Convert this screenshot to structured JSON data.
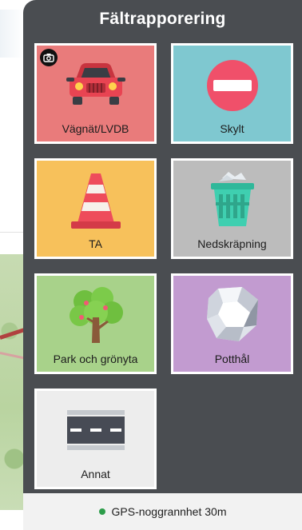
{
  "panel": {
    "title": "Fältrapporering"
  },
  "tiles": [
    {
      "label": "Vägnät/LVDB",
      "icon": "car-icon",
      "color": "#e97b7b"
    },
    {
      "label": "Skylt",
      "icon": "no-entry-sign-icon",
      "color": "#7fc8d0"
    },
    {
      "label": "TA",
      "icon": "traffic-cone-icon",
      "color": "#f7c15b"
    },
    {
      "label": "Nedskräpning",
      "icon": "trash-bin-icon",
      "color": "#bcbcbc"
    },
    {
      "label": "Park och grönyta",
      "icon": "tree-icon",
      "color": "#a8d28a"
    },
    {
      "label": "Potthål",
      "icon": "rock-icon",
      "color": "#c29bd0"
    },
    {
      "label": "Annat",
      "icon": "road-icon",
      "color": "#ededed"
    }
  ],
  "footer": {
    "gps_text": "GPS-noggrannhet 30m",
    "status_color": "#2d9d4a"
  }
}
